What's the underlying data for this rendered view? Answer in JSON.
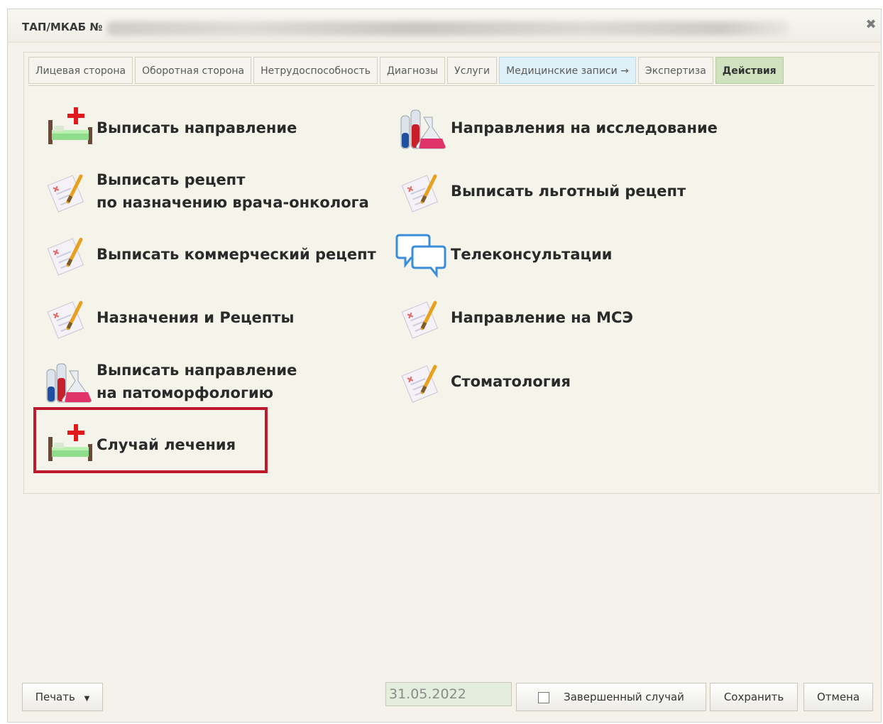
{
  "window": {
    "title": "ТАП/МКАБ №",
    "close_icon": "close-icon"
  },
  "tabs": [
    {
      "label": "Лицевая сторона"
    },
    {
      "label": "Оборотная сторона"
    },
    {
      "label": "Нетрудоспособность"
    },
    {
      "label": "Диагнозы"
    },
    {
      "label": "Услуги"
    },
    {
      "label": "Медицинские записи →"
    },
    {
      "label": "Экспертиза"
    },
    {
      "label": "Действия"
    }
  ],
  "active_tab": "Действия",
  "actions": {
    "issue_referral": {
      "label": "Выписать направление",
      "icon": "hospital-bed-icon"
    },
    "research_referrals": {
      "label": "Направления на исследование",
      "icon": "lab-flasks-icon"
    },
    "oncology_recipe": {
      "line1": "Выписать рецепт",
      "line2": "по назначению врача-онколога",
      "icon": "prescription-icon"
    },
    "preferential_recipe": {
      "label": "Выписать льготный рецепт",
      "icon": "prescription-icon"
    },
    "commercial_recipe": {
      "label": "Выписать коммерческий рецепт",
      "icon": "prescription-icon"
    },
    "teleconsultations": {
      "label": "Телеконсультации",
      "icon": "chat-bubbles-icon"
    },
    "prescriptions": {
      "label": "Назначения и Рецепты",
      "icon": "prescription-icon"
    },
    "mse_referral": {
      "label": "Направление на МСЭ",
      "icon": "prescription-icon"
    },
    "pathomorphology": {
      "line1": "Выписать направление",
      "line2": "на патоморфологию",
      "icon": "lab-flasks-icon"
    },
    "dentistry": {
      "label": "Стоматология",
      "icon": "prescription-icon"
    },
    "treatment_case": {
      "label": "Случай лечения",
      "icon": "hospital-bed-icon",
      "highlighted": true
    }
  },
  "footer": {
    "print_label": "Печать",
    "date_value": "31.05.2022",
    "completed_case_label": "Завершенный случай",
    "completed_case_checked": false,
    "save_label": "Сохранить",
    "cancel_label": "Отмена"
  },
  "colors": {
    "highlight": "#c0182c",
    "active_tab": "#cfe2c0",
    "medical_tab": "#dff1f8"
  }
}
